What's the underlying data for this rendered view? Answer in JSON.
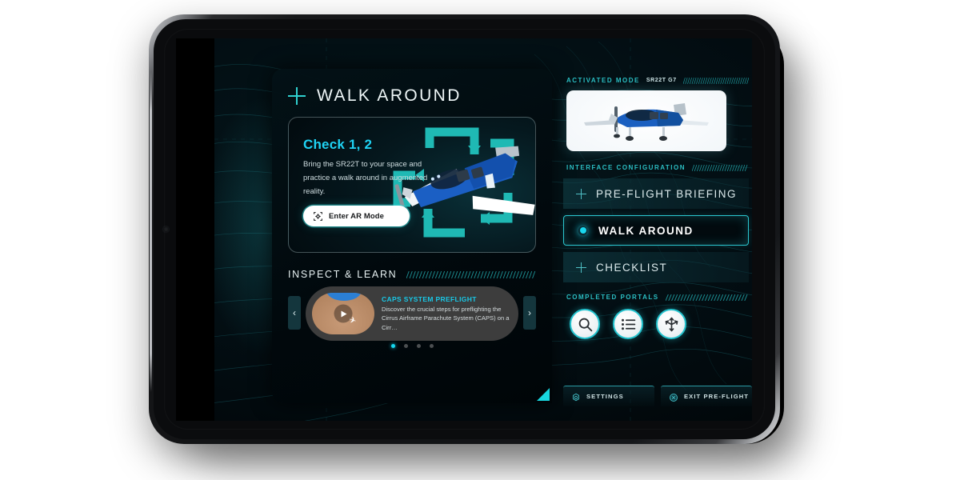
{
  "device": {
    "type": "tablet",
    "orientation": "landscape"
  },
  "app": {
    "main": {
      "page_title": "WALK AROUND",
      "header_icon": "crosshair-icon",
      "hero": {
        "title": "Check 1, 2",
        "body": "Bring the SR22T to your space and practice a walk around in augmented reality.",
        "button_label": "Enter AR Mode",
        "button_icon": "ar-cube-icon",
        "image_alt": "cirrus-sr22t-aircraft"
      },
      "inspect": {
        "section_label": "INSPECT & LEARN",
        "prev_icon": "chevron-left-icon",
        "next_icon": "chevron-right-icon",
        "card": {
          "title": "CAPS SYSTEM PREFLIGHT",
          "description": "Discover the crucial steps for preflighting the Cirrus Airframe Parachute System (CAPS) on a Cirr…",
          "thumb_icon": "play-icon"
        },
        "pagination": {
          "total": 4,
          "active": 1
        }
      }
    },
    "rail": {
      "activated_mode": {
        "label": "ACTIVATED MODE",
        "value": "SR22T G7",
        "image_alt": "cirrus-sr22t-front-view"
      },
      "interface_configuration": {
        "label": "INTERFACE CONFIGURATION",
        "items": [
          {
            "label": "PRE-FLIGHT BRIEFING",
            "icon": "plus-icon",
            "active": false
          },
          {
            "label": "WALK AROUND",
            "icon": "radio-selected-icon",
            "active": true
          },
          {
            "label": "CHECKLIST",
            "icon": "plus-icon",
            "active": false
          }
        ]
      },
      "completed_portals": {
        "label": "COMPLETED PORTALS",
        "items": [
          {
            "name": "magnifier-icon"
          },
          {
            "name": "list-icon"
          },
          {
            "name": "ar-move-icon"
          }
        ]
      },
      "bottom_bar": [
        {
          "label": "SETTINGS",
          "icon": "gear-icon"
        },
        {
          "label": "EXIT PRE-FLIGHT",
          "icon": "close-circle-icon"
        }
      ]
    }
  },
  "colors": {
    "accent_cyan": "#19d8ef",
    "teal": "#2bc6cf",
    "panel_dark": "#01070a",
    "text_light": "#dceaec"
  }
}
